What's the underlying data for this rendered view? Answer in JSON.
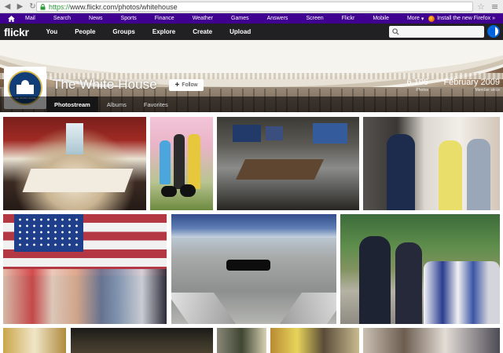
{
  "browser": {
    "url_protocol": "https://",
    "url_rest": "www.flickr.com/photos/whitehouse"
  },
  "yahoo_bar": {
    "links": [
      "Mail",
      "Search",
      "News",
      "Sports",
      "Finance",
      "Weather",
      "Games",
      "Answers",
      "Screen",
      "Flickr",
      "Mobile"
    ],
    "more_label": "More",
    "firefox_promo": "Install the new Firefox »",
    "colors": {
      "background": "#400090"
    }
  },
  "flickr_nav": {
    "logo": "flickr",
    "links": [
      "You",
      "People",
      "Groups",
      "Explore",
      "Create",
      "Upload"
    ],
    "colors": {
      "background": "#212124",
      "brand_blue": "#0063dc"
    }
  },
  "profile": {
    "name": "The White House",
    "follow_label": "Follow",
    "photos_count": "6,196",
    "photos_label": "Photos",
    "member_since": "February 2009",
    "member_since_label": "Member since",
    "avatar_seal_text": "THE WHITE HOUSE"
  },
  "tabs": [
    {
      "label": "Photostream",
      "active": true
    },
    {
      "label": "Albums",
      "active": false
    },
    {
      "label": "Favorites",
      "active": false
    }
  ],
  "icons": {
    "back": "back-arrow-icon",
    "forward": "forward-arrow-icon",
    "reload": "reload-icon",
    "lock": "lock-icon",
    "bookmark": "star-icon",
    "menu": "hamburger-menu-icon",
    "home": "yahoo-home-icon",
    "search": "search-icon",
    "account": "account-icon",
    "more_caret": "chevron-down-icon"
  }
}
